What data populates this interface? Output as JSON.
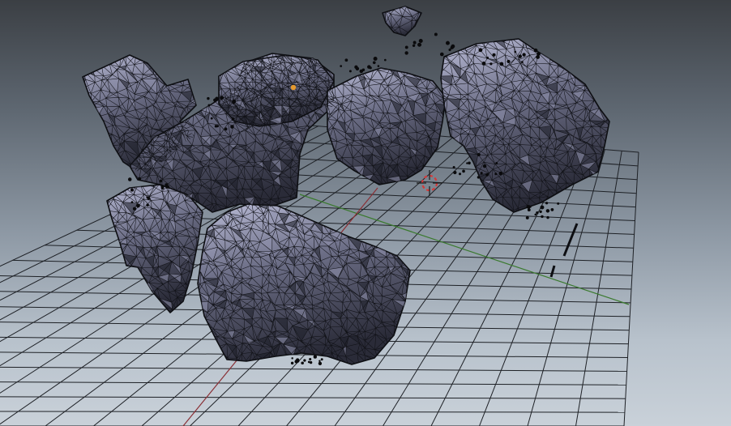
{
  "viewport": {
    "title": "",
    "view_type": "3d-viewport-perspective",
    "background_top": "#3b3f44",
    "background_bottom": "#c9d1d9"
  },
  "mesh": {
    "name": "",
    "display": "wireframe-over-solid",
    "fill_color": "#6b6d85",
    "highlight_color": "#b9bbd6",
    "wire_color": "#111217"
  },
  "axes": {
    "x_axis_color": "#3a7a2e",
    "y_axis_color": "#8a2f35"
  },
  "cursor": {
    "icon": "3d-cursor-icon",
    "ring_color": "#d23b3b"
  },
  "origin_marker": {
    "icon": "object-origin-icon",
    "color": "#e59a2f"
  }
}
